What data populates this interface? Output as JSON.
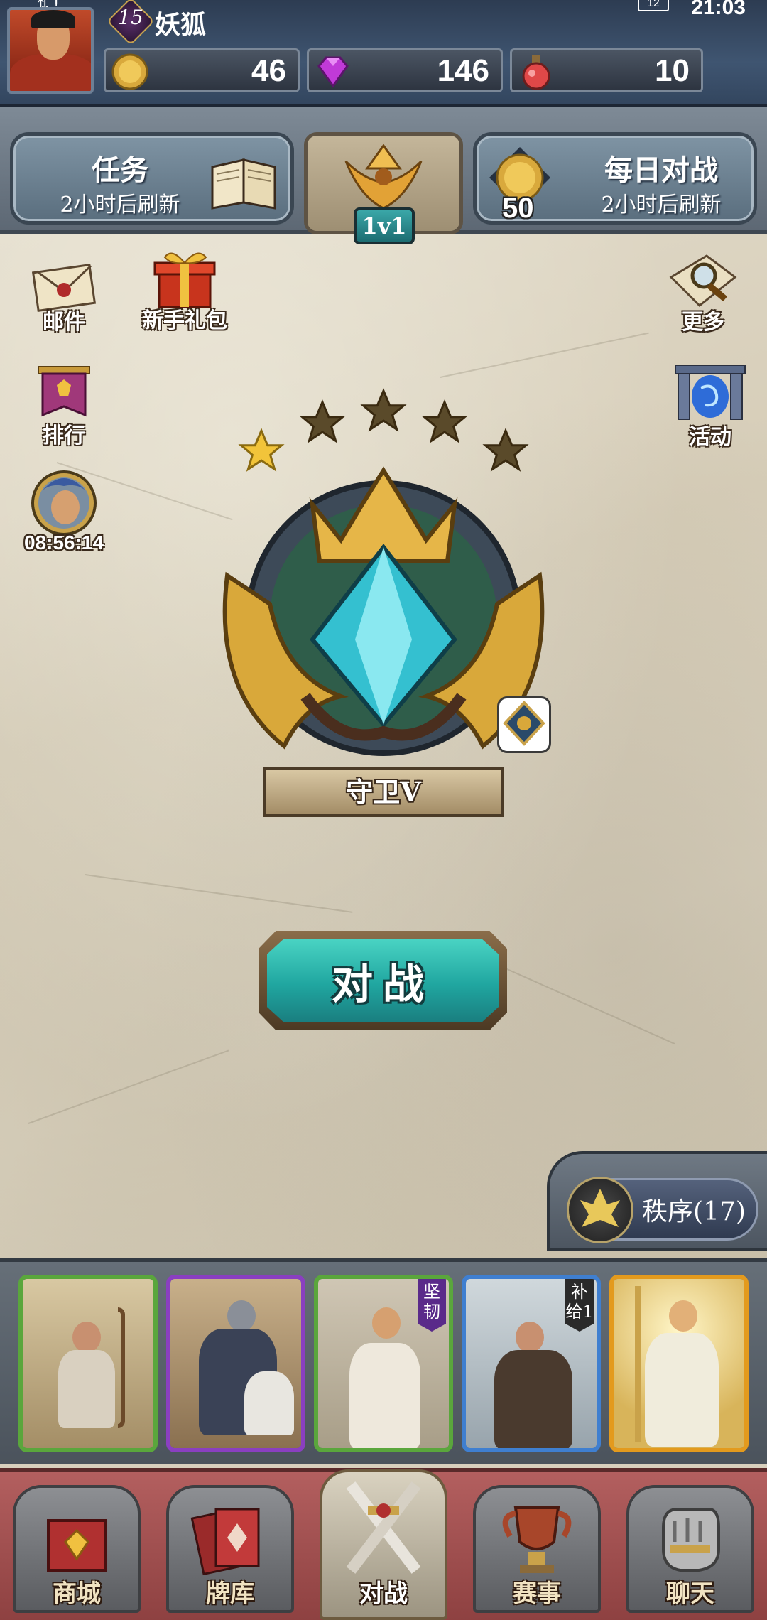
{
  "status_bar": {
    "time": "21:03",
    "battery": "12"
  },
  "player": {
    "level": "15",
    "name": "妖狐"
  },
  "resources": {
    "gold": "46",
    "gems": "146",
    "potions": "10"
  },
  "quests": {
    "tasks": {
      "title": "任务",
      "subtitle": "2小时后刷新"
    },
    "mode": {
      "label": "1v1"
    },
    "daily": {
      "title": "每日对战",
      "subtitle": "2小时后刷新",
      "reward": "50"
    }
  },
  "side_left": {
    "mail": "邮件",
    "newbie_pack": "新手礼包",
    "ranking": "排行",
    "timer": "08:56:14"
  },
  "side_right": {
    "more": "更多",
    "events": "活动"
  },
  "rank": {
    "name": "守卫V",
    "stars_total": 5,
    "stars_filled": 1
  },
  "battle_button": "对战",
  "faction": {
    "label": "秩序(17)"
  },
  "deck": [
    {
      "rarity": "common",
      "tag": ""
    },
    {
      "rarity": "epic",
      "tag": ""
    },
    {
      "rarity": "common",
      "tag": "坚韧"
    },
    {
      "rarity": "rare",
      "tag": "补给1"
    },
    {
      "rarity": "legendary",
      "tag": ""
    }
  ],
  "nav": {
    "shop": "商城",
    "deck": "牌库",
    "battle": "对战",
    "events": "赛事",
    "chat": "聊天"
  },
  "colors": {
    "accent_teal": "#20a6a0",
    "common_frame": "#5aa63c",
    "epic_frame": "#8a3fc0",
    "rare_frame": "#3f7fd0",
    "legendary_frame": "#e39a1d",
    "nav_red": "#a35050"
  }
}
